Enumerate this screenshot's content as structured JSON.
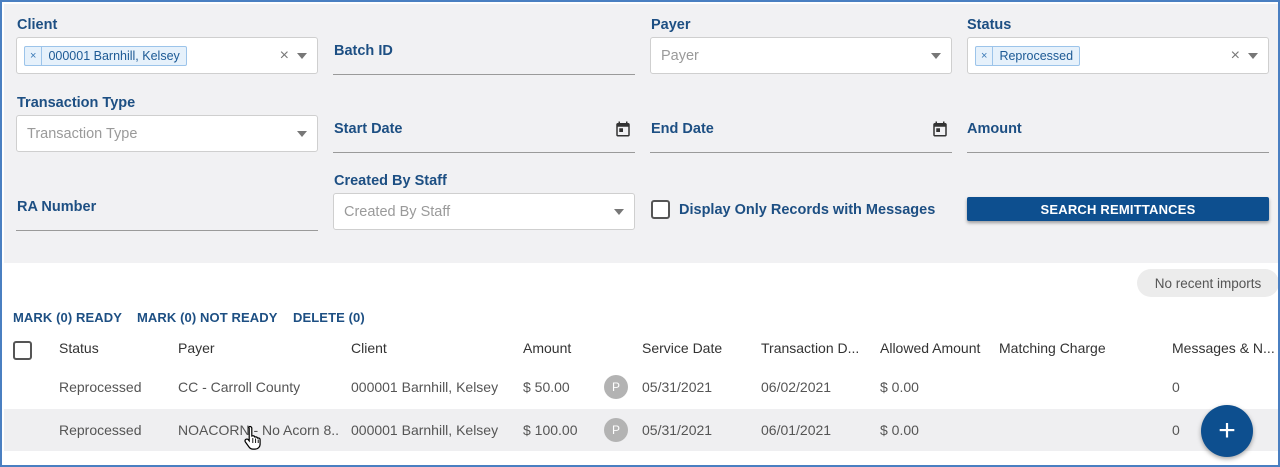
{
  "filters": {
    "client": {
      "label": "Client",
      "chip": "000001 Barnhill, Kelsey",
      "chip_remove": "×",
      "clear": "×"
    },
    "batch_id": {
      "label": "Batch ID"
    },
    "payer": {
      "label": "Payer",
      "placeholder": "Payer"
    },
    "status": {
      "label": "Status",
      "chip": "Reprocessed",
      "chip_remove": "×",
      "clear": "×"
    },
    "transaction_type": {
      "label": "Transaction Type",
      "placeholder": "Transaction Type"
    },
    "start_date": {
      "label": "Start Date"
    },
    "end_date": {
      "label": "End Date"
    },
    "amount": {
      "label": "Amount"
    },
    "ra_number": {
      "label": "RA Number"
    },
    "created_by_staff": {
      "label": "Created By Staff",
      "placeholder": "Created By Staff"
    },
    "messages_only": {
      "label": "Display Only Records with Messages",
      "checked": false
    },
    "search_button": "SEARCH REMITTANCES"
  },
  "imports_status": "No recent imports",
  "actions": {
    "mark_ready": "MARK (0) READY",
    "mark_not_ready": "MARK (0) NOT READY",
    "delete": "DELETE (0)"
  },
  "table": {
    "headers": [
      "Status",
      "Payer",
      "Client",
      "Amount",
      "Service Date",
      "Transaction D...",
      "Allowed Amount",
      "Matching Charge",
      "Messages & N..."
    ],
    "rows": [
      {
        "status": "Reprocessed",
        "payer": "CC - Carroll County",
        "client": "000001 Barnhill, Kelsey",
        "amount": "$ 50.00",
        "badge": "P",
        "service_date": "05/31/2021",
        "transaction_date": "06/02/2021",
        "allowed_amount": "$ 0.00",
        "matching_charge": "",
        "messages": "0"
      },
      {
        "status": "Reprocessed",
        "payer": "NOACORN - No Acorn 8...",
        "client": "000001 Barnhill, Kelsey",
        "amount": "$ 100.00",
        "badge": "P",
        "service_date": "05/31/2021",
        "transaction_date": "06/01/2021",
        "allowed_amount": "$ 0.00",
        "matching_charge": "",
        "messages": "0"
      }
    ]
  },
  "fab_label": "+",
  "colors": {
    "accent": "#0d4f8f",
    "label": "#1d4f83",
    "chip_bg": "#e6f1fb"
  }
}
